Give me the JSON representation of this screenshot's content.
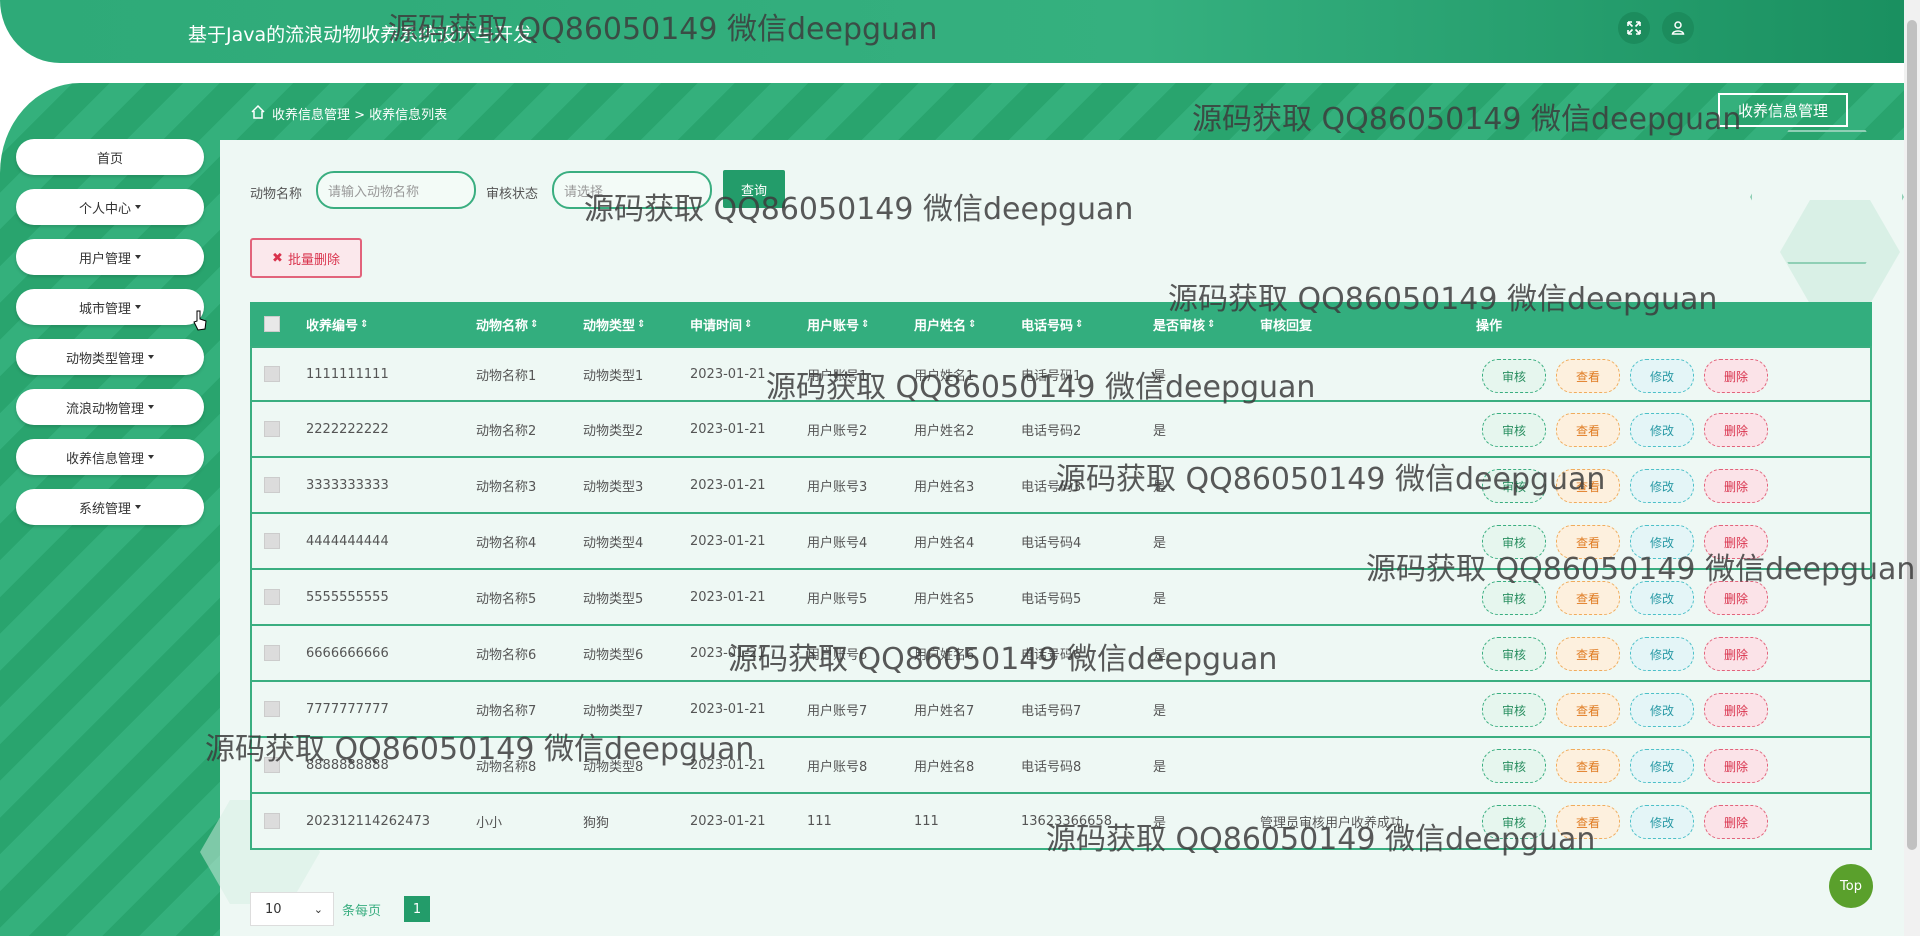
{
  "header": {
    "app_title": "基于Java的流浪动物收养系统设计与开发",
    "icons": [
      "fullscreen-icon",
      "user-icon"
    ]
  },
  "breadcrumb": {
    "home_icon": "home-icon",
    "text": "收养信息管理 > 收养信息列表",
    "right_button": "收养信息管理"
  },
  "sidebar": {
    "items": [
      {
        "label": "首页",
        "caret": false
      },
      {
        "label": "个人中心",
        "caret": true
      },
      {
        "label": "用户管理",
        "caret": true
      },
      {
        "label": "城市管理",
        "caret": true
      },
      {
        "label": "动物类型管理",
        "caret": true
      },
      {
        "label": "流浪动物管理",
        "caret": true
      },
      {
        "label": "收养信息管理",
        "caret": true
      },
      {
        "label": "系统管理",
        "caret": true
      }
    ]
  },
  "search": {
    "animal_name_label": "动物名称",
    "animal_name_placeholder": "请输入动物名称",
    "status_label": "审核状态",
    "status_placeholder": "请选择",
    "search_button": "查询"
  },
  "bulk_delete": "批量删除",
  "table": {
    "headers": [
      "收养编号",
      "动物名称",
      "动物类型",
      "申请时间",
      "用户账号",
      "用户姓名",
      "电话号码",
      "是否审核",
      "审核回复",
      "操作"
    ],
    "actions": {
      "audit": "审核",
      "view": "查看",
      "edit": "修改",
      "delete": "删除"
    },
    "rows": [
      {
        "id": "1111111111",
        "name": "动物名称1",
        "type": "动物类型1",
        "date": "2023-01-21",
        "account": "用户账号1",
        "username": "用户姓名1",
        "phone": "电话号码1",
        "audited": "是",
        "reply": ""
      },
      {
        "id": "2222222222",
        "name": "动物名称2",
        "type": "动物类型2",
        "date": "2023-01-21",
        "account": "用户账号2",
        "username": "用户姓名2",
        "phone": "电话号码2",
        "audited": "是",
        "reply": ""
      },
      {
        "id": "3333333333",
        "name": "动物名称3",
        "type": "动物类型3",
        "date": "2023-01-21",
        "account": "用户账号3",
        "username": "用户姓名3",
        "phone": "电话号码3",
        "audited": "是",
        "reply": ""
      },
      {
        "id": "4444444444",
        "name": "动物名称4",
        "type": "动物类型4",
        "date": "2023-01-21",
        "account": "用户账号4",
        "username": "用户姓名4",
        "phone": "电话号码4",
        "audited": "是",
        "reply": ""
      },
      {
        "id": "5555555555",
        "name": "动物名称5",
        "type": "动物类型5",
        "date": "2023-01-21",
        "account": "用户账号5",
        "username": "用户姓名5",
        "phone": "电话号码5",
        "audited": "是",
        "reply": ""
      },
      {
        "id": "6666666666",
        "name": "动物名称6",
        "type": "动物类型6",
        "date": "2023-01-21",
        "account": "用户账号6",
        "username": "用户姓名6",
        "phone": "电话号码6",
        "audited": "是",
        "reply": ""
      },
      {
        "id": "7777777777",
        "name": "动物名称7",
        "type": "动物类型7",
        "date": "2023-01-21",
        "account": "用户账号7",
        "username": "用户姓名7",
        "phone": "电话号码7",
        "audited": "是",
        "reply": ""
      },
      {
        "id": "8888888888",
        "name": "动物名称8",
        "type": "动物类型8",
        "date": "2023-01-21",
        "account": "用户账号8",
        "username": "用户姓名8",
        "phone": "电话号码8",
        "audited": "是",
        "reply": ""
      },
      {
        "id": "202312114262473",
        "name": "小小",
        "type": "狗狗",
        "date": "2023-01-21",
        "account": "111",
        "username": "111",
        "phone": "13623366658",
        "audited": "是",
        "reply": "管理员审核用户收养成功"
      }
    ]
  },
  "pagination": {
    "page_size": "10",
    "per_page_label": "条每页",
    "current_page": "1"
  },
  "top_button": "Top",
  "watermark": "源码获取 QQ86050149 微信deepguan"
}
